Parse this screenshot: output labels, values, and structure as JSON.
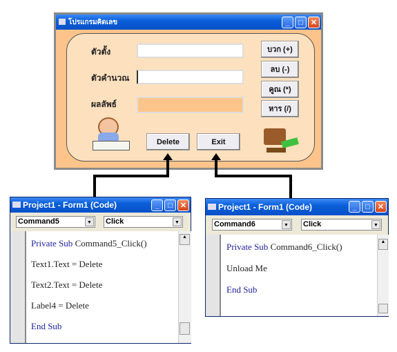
{
  "form": {
    "title": "โปรแกรมคิดเลข",
    "labels": [
      "ตัวตั้ง",
      "ตัวคำนวณ",
      "ผลลัพธ์"
    ],
    "op_buttons": [
      "บวก (+)",
      "ลบ (-)",
      "คูณ (*)",
      "หาร (/)"
    ],
    "delete_label": "Delete",
    "exit_label": "Exit",
    "result_color": "#fcc48a"
  },
  "code_windows": [
    {
      "title": "Project1 - Form1 (Code)",
      "object": "Command5",
      "procedure": "Click",
      "lines": [
        [
          "Private Sub ",
          "Command5_Click()"
        ],
        [
          "",
          "Text1.Text = Delete"
        ],
        [
          "",
          "Text2.Text = Delete"
        ],
        [
          "",
          "Label4 = Delete"
        ],
        [
          "End Sub",
          ""
        ]
      ]
    },
    {
      "title": "Project1 - Form1 (Code)",
      "object": "Command6",
      "procedure": "Click",
      "lines": [
        [
          "Private Sub ",
          "Command6_Click()"
        ],
        [
          "",
          "Unload Me"
        ],
        [
          "End Sub",
          ""
        ]
      ]
    }
  ]
}
